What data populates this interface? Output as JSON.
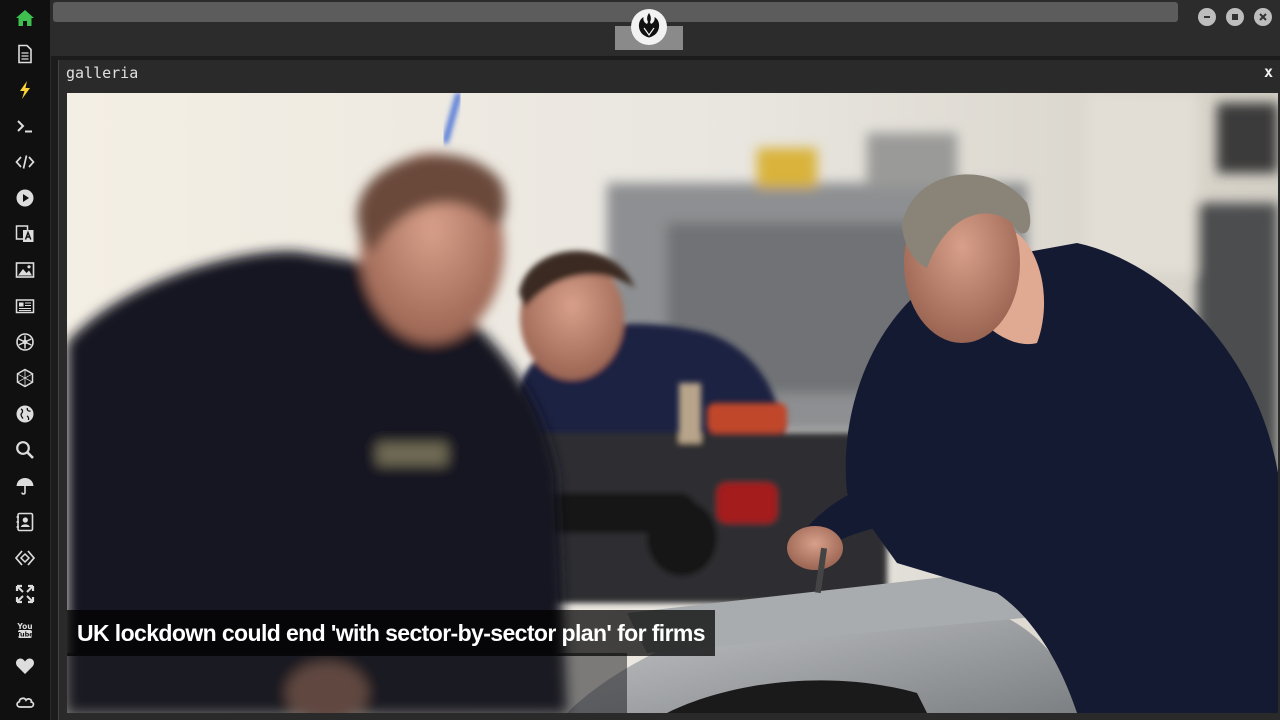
{
  "gallery": {
    "title": "galleria",
    "close_label": "x",
    "caption": "UK lockdown could end 'with sector-by-sector plan' for firms"
  },
  "sidebar": {
    "items": [
      {
        "icon": "home-icon",
        "color": "#3fbf4f"
      },
      {
        "icon": "document-icon"
      },
      {
        "icon": "lightning-icon",
        "color": "#ffd23a"
      },
      {
        "icon": "terminal-icon"
      },
      {
        "icon": "code-icon"
      },
      {
        "icon": "play-icon"
      },
      {
        "icon": "translate-icon"
      },
      {
        "icon": "image-icon"
      },
      {
        "icon": "newspaper-icon"
      },
      {
        "icon": "rebel-alliance-icon"
      },
      {
        "icon": "hexagon-network-icon"
      },
      {
        "icon": "globe-icon"
      },
      {
        "icon": "search-icon"
      },
      {
        "icon": "umbrella-icon"
      },
      {
        "icon": "contact-card-icon"
      },
      {
        "icon": "diamond-code-icon"
      },
      {
        "icon": "expand-icon"
      },
      {
        "icon": "youtube-icon"
      },
      {
        "icon": "heart-icon"
      },
      {
        "icon": "cloud-icon"
      }
    ]
  },
  "window_controls": [
    "minimize-icon",
    "maximize-icon",
    "close-icon"
  ],
  "colors": {
    "sidebar_bg": "#101010",
    "home_accent": "#3fbf4f",
    "lightning_accent": "#ffd23a",
    "caption_bg": "#000000"
  }
}
